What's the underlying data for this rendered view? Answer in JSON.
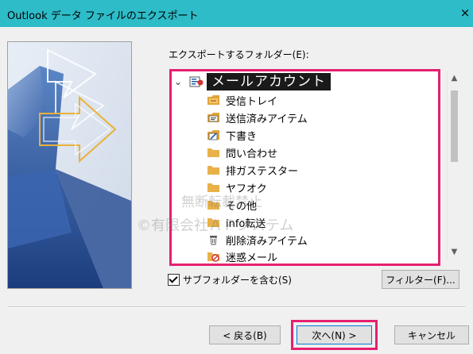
{
  "window": {
    "title": "Outlook データ ファイルのエクスポート",
    "close_glyph": "×"
  },
  "folder_section": {
    "label": "エクスポートするフォルダー(E):"
  },
  "tree": {
    "root": {
      "label": "メールアカウント",
      "expanded": true
    },
    "items": [
      {
        "label": "受信トレイ",
        "icon": "inbox-icon"
      },
      {
        "label": "送信済みアイテム",
        "icon": "sent-items-icon"
      },
      {
        "label": "下書き",
        "icon": "drafts-icon"
      },
      {
        "label": "問い合わせ",
        "icon": "folder-icon"
      },
      {
        "label": "排ガステスター",
        "icon": "folder-icon"
      },
      {
        "label": "ヤフオク",
        "icon": "folder-icon"
      },
      {
        "label": "その他",
        "icon": "folder-icon"
      },
      {
        "label": "info転送",
        "icon": "folder-icon"
      },
      {
        "label": "削除済みアイテム",
        "icon": "trash-icon"
      },
      {
        "label": "迷惑メール",
        "icon": "junk-mail-icon"
      }
    ]
  },
  "options": {
    "include_subfolders_label": "サブフォルダーを含む(S)",
    "include_subfolders_checked": true,
    "filter_button": "フィルター(F)..."
  },
  "footer": {
    "back_button": "< 戻る(B)",
    "next_button": "次へ(N) >",
    "cancel_button": "キャンセル"
  },
  "watermark": {
    "line1": "無断転載禁止",
    "line2": "©有限会社ＡＰシステム"
  },
  "colors": {
    "titlebar": "#2dbcc8",
    "highlight": "#e5206f",
    "dialog_bg": "#f0f0f0"
  }
}
